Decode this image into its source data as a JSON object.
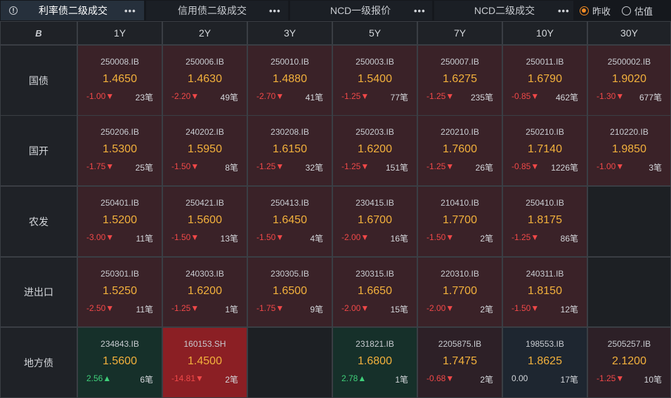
{
  "tabs": [
    {
      "label": "利率债二级成交",
      "active": true
    },
    {
      "label": "信用债二级成交",
      "active": false
    },
    {
      "label": "NCD一级报价",
      "active": false
    },
    {
      "label": "NCD二级成交",
      "active": false
    }
  ],
  "more_label": "•••",
  "radio": {
    "yesterday": "昨收",
    "estimate": "估值",
    "selected": "yesterday"
  },
  "corner_icon": "B",
  "columns": [
    "1Y",
    "2Y",
    "3Y",
    "5Y",
    "7Y",
    "10Y",
    "30Y"
  ],
  "rows": [
    {
      "label": "国债",
      "cells": [
        {
          "code": "250008.IB",
          "price": "1.4650",
          "change": "-1.00▼",
          "count": "23笔",
          "tone": "red"
        },
        {
          "code": "250006.IB",
          "price": "1.4630",
          "change": "-2.20▼",
          "count": "49笔",
          "tone": "red"
        },
        {
          "code": "250010.IB",
          "price": "1.4880",
          "change": "-2.70▼",
          "count": "41笔",
          "tone": "red"
        },
        {
          "code": "250003.IB",
          "price": "1.5400",
          "change": "-1.25▼",
          "count": "77笔",
          "tone": "red"
        },
        {
          "code": "250007.IB",
          "price": "1.6275",
          "change": "-1.25▼",
          "count": "235笔",
          "tone": "red"
        },
        {
          "code": "250011.IB",
          "price": "1.6790",
          "change": "-0.85▼",
          "count": "462笔",
          "tone": "red"
        },
        {
          "code": "2500002.IB",
          "price": "1.9020",
          "change": "-1.30▼",
          "count": "677笔",
          "tone": "red"
        }
      ]
    },
    {
      "label": "国开",
      "cells": [
        {
          "code": "250206.IB",
          "price": "1.5300",
          "change": "-1.75▼",
          "count": "25笔",
          "tone": "red"
        },
        {
          "code": "240202.IB",
          "price": "1.5950",
          "change": "-1.50▼",
          "count": "8笔",
          "tone": "red"
        },
        {
          "code": "230208.IB",
          "price": "1.6150",
          "change": "-1.25▼",
          "count": "32笔",
          "tone": "red"
        },
        {
          "code": "250203.IB",
          "price": "1.6200",
          "change": "-1.25▼",
          "count": "151笔",
          "tone": "red"
        },
        {
          "code": "220210.IB",
          "price": "1.7600",
          "change": "-1.25▼",
          "count": "26笔",
          "tone": "red"
        },
        {
          "code": "250210.IB",
          "price": "1.7140",
          "change": "-0.85▼",
          "count": "1226笔",
          "tone": "red"
        },
        {
          "code": "210220.IB",
          "price": "1.9850",
          "change": "-1.00▼",
          "count": "3笔",
          "tone": "red"
        }
      ]
    },
    {
      "label": "农发",
      "cells": [
        {
          "code": "250401.IB",
          "price": "1.5200",
          "change": "-3.00▼",
          "count": "11笔",
          "tone": "red"
        },
        {
          "code": "250421.IB",
          "price": "1.5600",
          "change": "-1.50▼",
          "count": "13笔",
          "tone": "red"
        },
        {
          "code": "250413.IB",
          "price": "1.6450",
          "change": "-1.50▼",
          "count": "4笔",
          "tone": "red"
        },
        {
          "code": "230415.IB",
          "price": "1.6700",
          "change": "-2.00▼",
          "count": "16笔",
          "tone": "red"
        },
        {
          "code": "210410.IB",
          "price": "1.7700",
          "change": "-1.50▼",
          "count": "2笔",
          "tone": "red"
        },
        {
          "code": "250410.IB",
          "price": "1.8175",
          "change": "-1.25▼",
          "count": "86笔",
          "tone": "red"
        },
        null
      ]
    },
    {
      "label": "进出口",
      "cells": [
        {
          "code": "250301.IB",
          "price": "1.5250",
          "change": "-2.50▼",
          "count": "11笔",
          "tone": "red"
        },
        {
          "code": "240303.IB",
          "price": "1.6200",
          "change": "-1.25▼",
          "count": "1笔",
          "tone": "red"
        },
        {
          "code": "230305.IB",
          "price": "1.6500",
          "change": "-1.75▼",
          "count": "9笔",
          "tone": "red"
        },
        {
          "code": "230315.IB",
          "price": "1.6650",
          "change": "-2.00▼",
          "count": "15笔",
          "tone": "red"
        },
        {
          "code": "220310.IB",
          "price": "1.7700",
          "change": "-2.00▼",
          "count": "2笔",
          "tone": "red"
        },
        {
          "code": "240311.IB",
          "price": "1.8150",
          "change": "-1.50▼",
          "count": "12笔",
          "tone": "red"
        },
        null
      ]
    },
    {
      "label": "地方债",
      "cells": [
        {
          "code": "234843.IB",
          "price": "1.5600",
          "change": "2.56▲",
          "count": "6笔",
          "tone": "green"
        },
        {
          "code": "160153.SH",
          "price": "1.4500",
          "change": "-14.81▼",
          "count": "2笔",
          "tone": "brightred"
        },
        null,
        {
          "code": "231821.IB",
          "price": "1.6800",
          "change": "2.78▲",
          "count": "1笔",
          "tone": "green"
        },
        {
          "code": "2205875.IB",
          "price": "1.7475",
          "change": "-0.68▼",
          "count": "2笔",
          "tone": "dark"
        },
        {
          "code": "198553.IB",
          "price": "1.8625",
          "change": "0.00",
          "count": "17笔",
          "tone": "slate"
        },
        {
          "code": "2505257.IB",
          "price": "2.1200",
          "change": "-1.25▼",
          "count": "10笔",
          "tone": "dark"
        }
      ]
    }
  ],
  "colors": {
    "accent": "#f08a24",
    "price": "#f3b13c",
    "down": "#f04848",
    "up": "#3fd07a"
  }
}
